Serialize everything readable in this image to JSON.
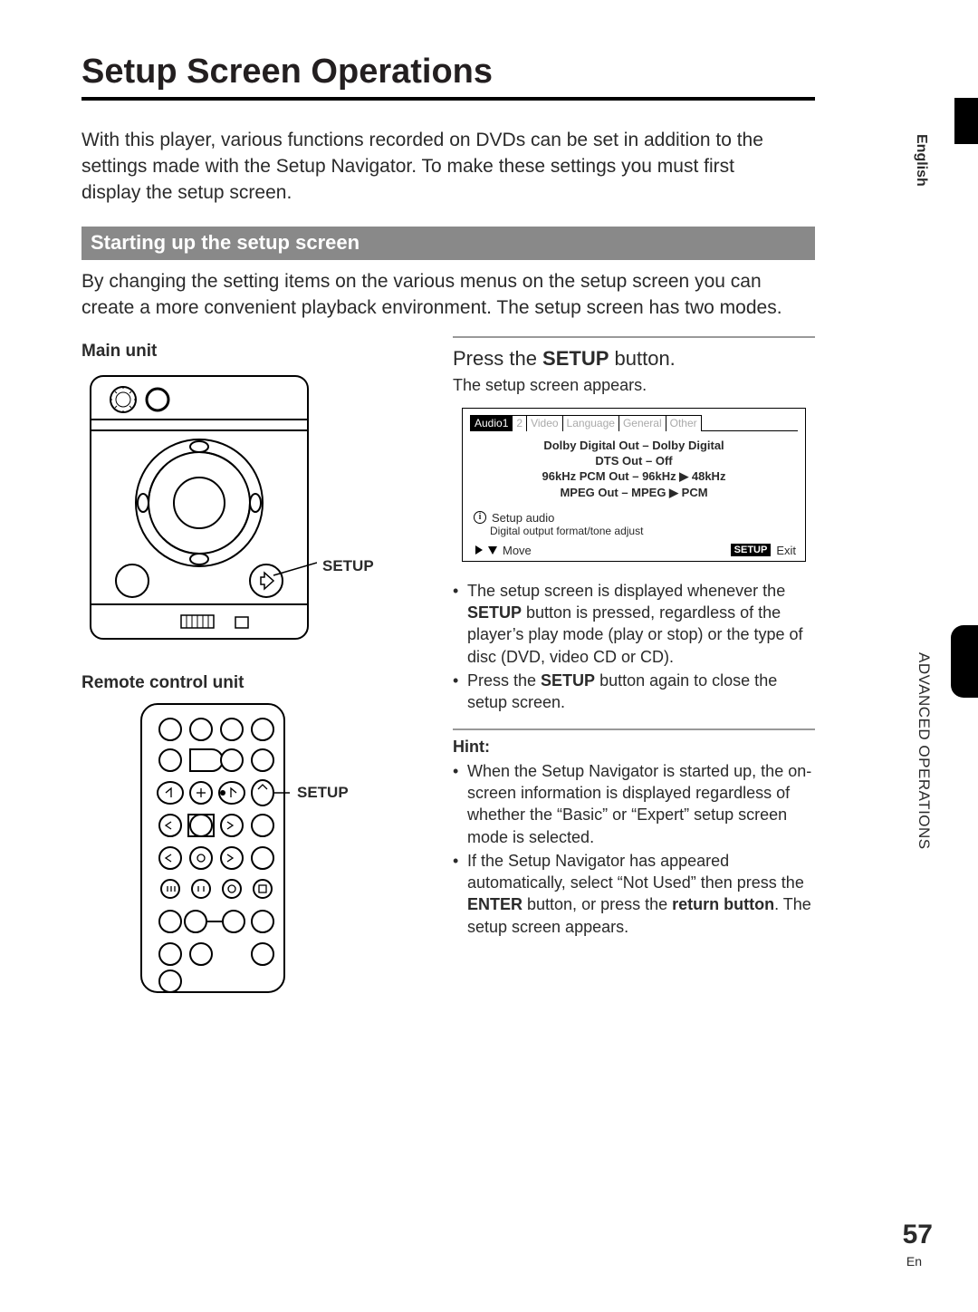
{
  "page": {
    "title": "Setup Screen Operations",
    "intro": "With this player, various functions recorded on DVDs can be set in addition to the settings made with the Setup Navigator.  To make these settings you must first display the setup screen.",
    "section_bar": "Starting up the setup screen",
    "section_intro": "By changing the setting items on the various menus on the setup screen you can create a more convenient playback environment.  The setup screen has two modes.",
    "main_unit_heading": "Main unit",
    "setup_label_a": "SETUP",
    "remote_heading": "Remote control unit",
    "setup_label_b": "SETUP",
    "press_prefix": "Press the ",
    "press_bold": "SETUP",
    "press_suffix": " button.",
    "appears": "The setup screen appears.",
    "osd": {
      "tabs": [
        "Audio1",
        "2",
        "Video",
        "Language",
        "General",
        "Other"
      ],
      "items": [
        "Dolby Digital Out – Dolby Digital",
        "DTS Out – Off",
        "96kHz PCM Out – 96kHz ▶ 48kHz",
        "MPEG Out – MPEG ▶ PCM"
      ],
      "info_line": "Setup audio",
      "info_desc": "Digital output format/tone adjust",
      "move": "Move",
      "setup_btn": "SETUP",
      "exit": "Exit"
    },
    "bullets1": {
      "a_pre": "The setup screen is displayed whenever the ",
      "a_b": "SETUP",
      "a_post": " button is pressed, regardless of the player’s play mode (play or stop) or the type of disc (DVD, video CD or CD).",
      "b_pre": "Press the ",
      "b_b": "SETUP",
      "b_post": " button again to close the setup screen."
    },
    "hint_heading": "Hint:",
    "bullets2": {
      "a": "When the Setup Navigator is started up, the on-screen information is displayed regardless of whether the “Basic” or “Expert” setup screen mode is selected.",
      "b_pre": "If the Setup Navigator has appeared automatically, select “Not Used” then press the ",
      "b_b1": "ENTER",
      "b_mid": " button, or press the ",
      "b_b2": "return button",
      "b_post": ".  The setup screen appears."
    },
    "side_lang": "English",
    "side_section": "ADVANCED OPERATIONS",
    "page_number": "57",
    "page_lang": "En"
  }
}
